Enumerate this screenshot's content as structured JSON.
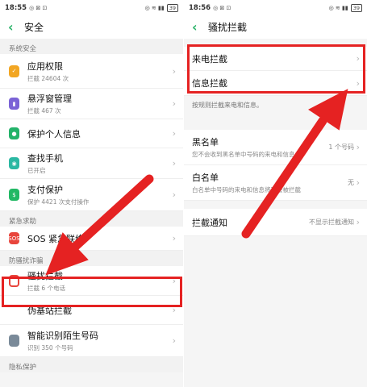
{
  "left": {
    "status": {
      "time": "18:55",
      "extra": "◎ ⊠ ⊡",
      "right": "◎ ≋ ▮▮",
      "battery": "39"
    },
    "title": "安全",
    "sections": [
      {
        "label": "系统安全",
        "items": [
          {
            "label": "应用权限",
            "sub": "拦截 24604 次"
          },
          {
            "label": "悬浮窗管理",
            "sub": "拦截 467 次"
          },
          {
            "label": "保护个人信息",
            "sub": ""
          },
          {
            "label": "查找手机",
            "sub": "已开启"
          },
          {
            "label": "支付保护",
            "sub": "保护 4421 次支付操作"
          }
        ]
      },
      {
        "label": "紧急求助",
        "items": [
          {
            "label": "SOS 紧急联络",
            "sub": ""
          }
        ]
      },
      {
        "label": "防骚扰诈骗",
        "items": [
          {
            "label": "骚扰拦截",
            "sub": "拦截 6 个电话"
          },
          {
            "label": "伪基站拦截",
            "sub": ""
          },
          {
            "label": "智能识别陌生号码",
            "sub": "识别 350 个号码"
          }
        ]
      }
    ],
    "footer_label": "隐私保护",
    "sos_icon_text": "SOS"
  },
  "right": {
    "status": {
      "time": "18:56",
      "extra": "◎ ⊠ ⊡",
      "right": "◎ ≋ ▮▮",
      "battery": "39"
    },
    "title": "骚扰拦截",
    "call_block": "来电拦截",
    "msg_block": "信息拦截",
    "desc": "按规则拦截来电和信息。",
    "blacklist": {
      "label": "黑名单",
      "sub": "您不会收到黑名单中号码的来电和信息",
      "value": "1 个号码"
    },
    "whitelist": {
      "label": "白名单",
      "sub": "白名单中号码的来电和信息将不会被拦截",
      "value": "无"
    },
    "notify": {
      "label": "拦截通知",
      "value": "不显示拦截通知"
    }
  },
  "chevron": "›",
  "back": "‹",
  "colors": {
    "accent_green": "#2bb36a",
    "highlight_red": "#e52222"
  }
}
